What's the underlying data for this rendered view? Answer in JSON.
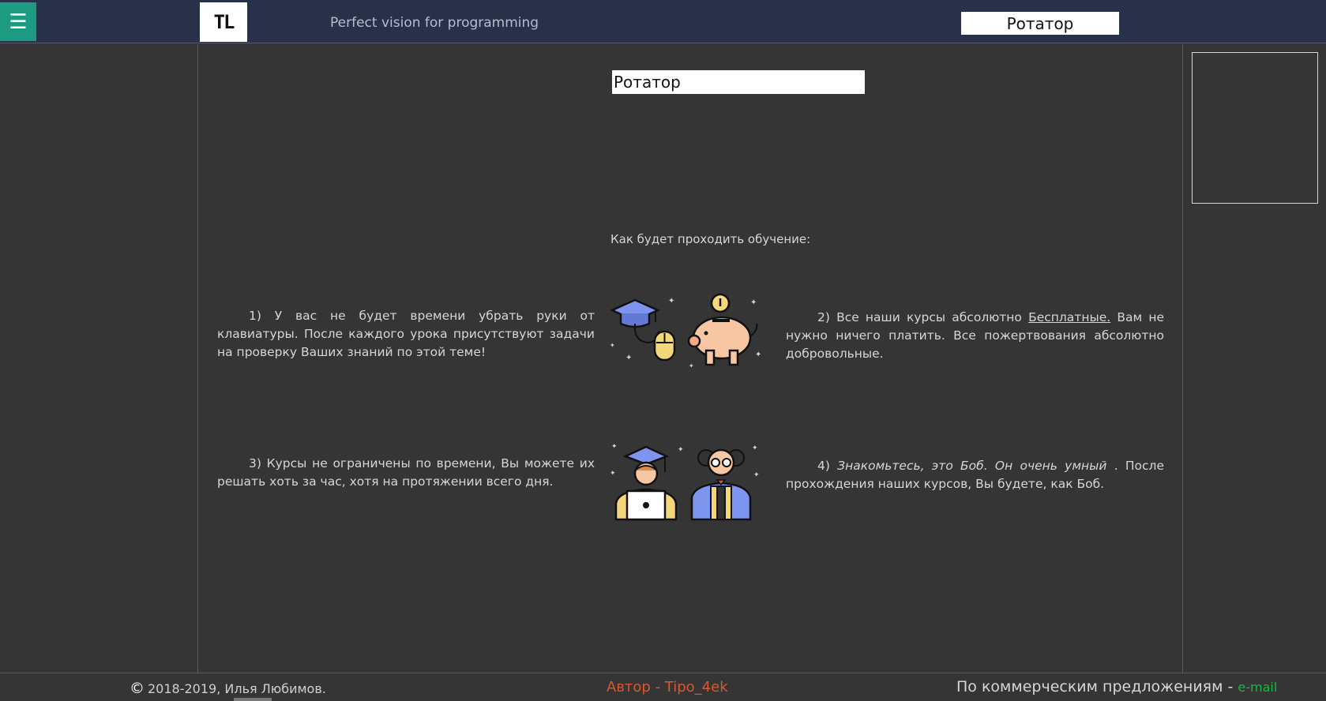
{
  "header": {
    "menu_icon": "☰",
    "logo_text": "TL",
    "tagline": "Perfect vision for programming",
    "rotator_label": "Ротатор"
  },
  "main": {
    "rotator_label": "Ротатор",
    "section_title": "Как будет проходить обучение:",
    "items": [
      {
        "text": "1) У вас не будет времени убрать руки от клавиатуры. После каждого урока присутствуют задачи на проверку Ваших знаний по этой теме!"
      },
      {
        "text_before": "2) Все наши курсы абсолютно ",
        "link": "Бесплатные.",
        "text_after": " Вам не нужно ничего платить. Все пожертвования абсолютно добровольные."
      },
      {
        "text": "3) Курсы не ограничены по времени, Вы можете их решать хоть за час, хотя на протяжении всего дня."
      },
      {
        "prefix": "4) ",
        "italic": "Знакомьтесь, это Боб. Он очень умный",
        "text_after": " . После прохождения наших курсов, Вы будете, как Боб."
      }
    ],
    "icons": [
      "graduation-cap-mouse-icon",
      "piggy-bank-icon",
      "student-laptop-icon",
      "professor-icon"
    ]
  },
  "footer": {
    "copyright_symbol": "©",
    "copyright_text": "2018-2019, Илья Любимов.",
    "author": "Автор - Tipo_4ek",
    "commercial_text": "По коммерческим предложениям - ",
    "email_link": "e-mail"
  },
  "colors": {
    "header_bg": "#283149",
    "body_bg": "#353535",
    "menu_accent": "#1d9b82",
    "author_color": "#d9572f",
    "email_color": "#18b83c"
  }
}
